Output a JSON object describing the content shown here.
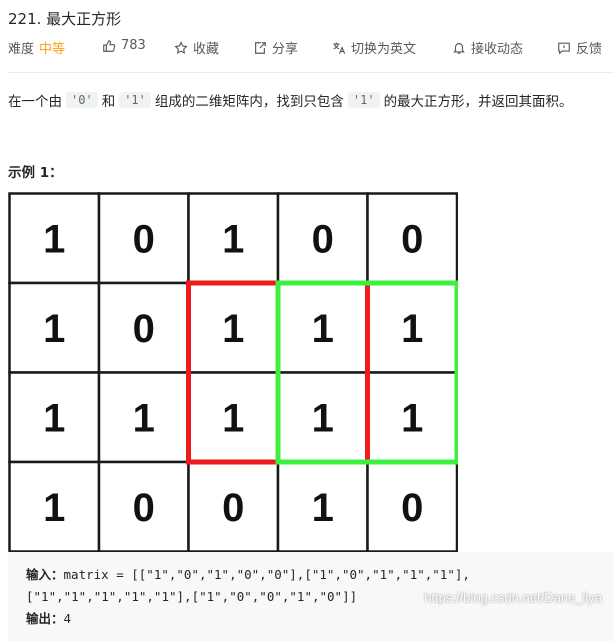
{
  "problem": {
    "title": "221. 最大正方形",
    "difficulty_label": "难度",
    "difficulty_value": "中等",
    "likes": "783",
    "favorite_label": "收藏",
    "share_label": "分享",
    "switch_lang_label": "切换为英文",
    "notify_label": "接收动态",
    "feedback_label": "反馈"
  },
  "description": {
    "part1": "在一个由",
    "code0": "'0'",
    "part2": "和",
    "code1": "'1'",
    "part3": "组成的二维矩阵内，找到只包含",
    "code2": "'1'",
    "part4": "的最大正方形，并返回其面积。"
  },
  "example": {
    "title": "示例 1：",
    "matrix": [
      [
        "1",
        "0",
        "1",
        "0",
        "0"
      ],
      [
        "1",
        "0",
        "1",
        "1",
        "1"
      ],
      [
        "1",
        "1",
        "1",
        "1",
        "1"
      ],
      [
        "1",
        "0",
        "0",
        "1",
        "0"
      ]
    ],
    "highlight_colors": {
      "red": "#ee1c1c",
      "green": "#3ef03e"
    },
    "input_label": "输入：",
    "input_line1": "matrix = [[\"1\",\"0\",\"1\",\"0\",\"0\"],[\"1\",\"0\",\"1\",\"1\",\"1\"],",
    "input_line2": "[\"1\",\"1\",\"1\",\"1\",\"1\"],[\"1\",\"0\",\"0\",\"1\",\"0\"]]",
    "output_label": "输出：",
    "output_value": "4"
  },
  "watermark": "https://blog.csdn.net/Dane_liya"
}
